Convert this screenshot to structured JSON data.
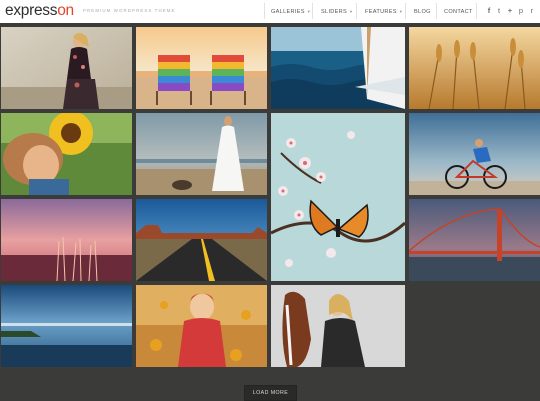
{
  "logo": {
    "part1": "express",
    "part2": "on"
  },
  "tagline": "PREMIUM WORDPRESS THEME",
  "nav": {
    "galleries": "GALLERIES",
    "sliders": "SLIDERS",
    "features": "FEATURES",
    "blog": "BLOG",
    "contact": "CONTACT"
  },
  "social": {
    "facebook": "f",
    "twitter": "t",
    "plus": "+",
    "pinterest": "p",
    "rss": "r"
  },
  "colors": {
    "brand_accent": "#e0462d",
    "background": "#3b3b39",
    "header": "#ffffff"
  },
  "gallery": [
    "woman-in-floral-dress",
    "beach-chairs-sunset",
    "sailboat-ocean-waves",
    "wheat-field",
    "child-with-sunflower",
    "bride-on-beach",
    "butterfly-on-blossom",
    "cyclist-at-sunset",
    "grass-at-sunset",
    "desert-highway",
    "golden-gate-bridge",
    "sea-at-dusk",
    "girl-with-autumn-leaves",
    "woman-with-horse"
  ],
  "load_more": "LOAD MORE"
}
